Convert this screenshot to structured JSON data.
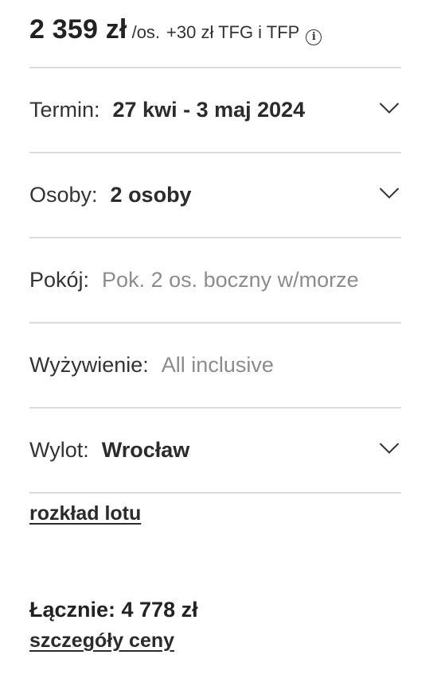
{
  "price": {
    "main": "2 359 zł",
    "per": "/os.",
    "extra": "+30 zł TFG i TFP",
    "info_icon": "ⓘ"
  },
  "fields": {
    "termin": {
      "label": "Termin:",
      "value": "27 kwi - 3 maj 2024",
      "icon": "chevron-down"
    },
    "osoby": {
      "label": "Osoby:",
      "value": "2 osoby",
      "icon": "chevron-down"
    },
    "pokoj": {
      "label": "Pokój:",
      "value": "Pok. 2 os. boczny w/morze"
    },
    "wyzywienie": {
      "label": "Wyżywienie:",
      "value": "All inclusive"
    },
    "wylot": {
      "label": "Wylot:",
      "value": "Wrocław",
      "icon": "chevron-down"
    }
  },
  "links": {
    "flight_schedule": "rozkład lotu",
    "price_details": "szczegóły ceny"
  },
  "total": "Łącznie: 4 778 zł"
}
